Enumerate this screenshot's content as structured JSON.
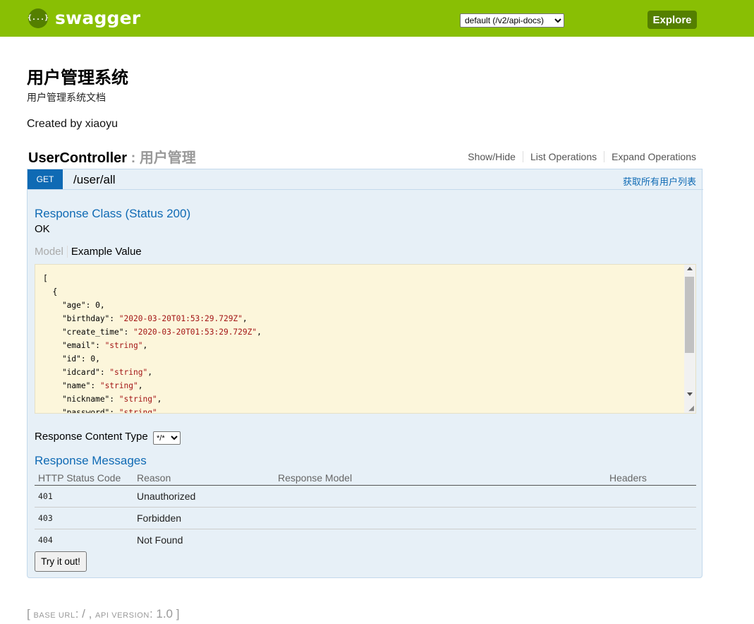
{
  "header": {
    "logo_glyph": "{...}",
    "logo_text": "swagger",
    "spec_selected": "default (/v2/api-docs)",
    "explore_label": "Explore",
    "bg_color": "#89bf04",
    "button_color": "#547f00"
  },
  "info": {
    "title": "用户管理系统",
    "description": "用户管理系统文档",
    "created_by": "Created by xiaoyu"
  },
  "resource": {
    "name": "UserController",
    "separator": " : ",
    "description": "用户管理",
    "links": [
      "Show/Hide",
      "List Operations",
      "Expand Operations"
    ]
  },
  "operation": {
    "method": "GET",
    "method_color": "#0f6ab4",
    "path": "/user/all",
    "summary": "获取所有用户列表",
    "response_class_title": "Response Class (Status 200)",
    "response_class_value": "OK",
    "tabs": [
      "Model",
      "Example Value"
    ],
    "example_lines": [
      "[",
      "  {",
      "    \"age\": 0,",
      "    \"birthday\": \"2020-03-20T01:53:29.729Z\",",
      "    \"create_time\": \"2020-03-20T01:53:29.729Z\",",
      "    \"email\": \"string\",",
      "    \"id\": 0,",
      "    \"idcard\": \"string\",",
      "    \"name\": \"string\",",
      "    \"nickname\": \"string\",",
      "    \"password\": \"string\","
    ],
    "response_content_type_label": "Response Content Type",
    "response_content_type_value": "*/*",
    "response_messages_title": "Response Messages",
    "table_headers": [
      "HTTP Status Code",
      "Reason",
      "Response Model",
      "Headers"
    ],
    "rows": [
      {
        "code": "401",
        "reason": "Unauthorized",
        "model": "",
        "headers": ""
      },
      {
        "code": "403",
        "reason": "Forbidden",
        "model": "",
        "headers": ""
      },
      {
        "code": "404",
        "reason": "Not Found",
        "model": "",
        "headers": ""
      }
    ],
    "try_button": "Try it out!"
  },
  "footer": {
    "open_bracket": "[",
    "base_url_label": "base url",
    "base_url_value": ": / , ",
    "api_version_label": "api version",
    "api_version_value": ": 1.0 ",
    "close_bracket": "]"
  }
}
